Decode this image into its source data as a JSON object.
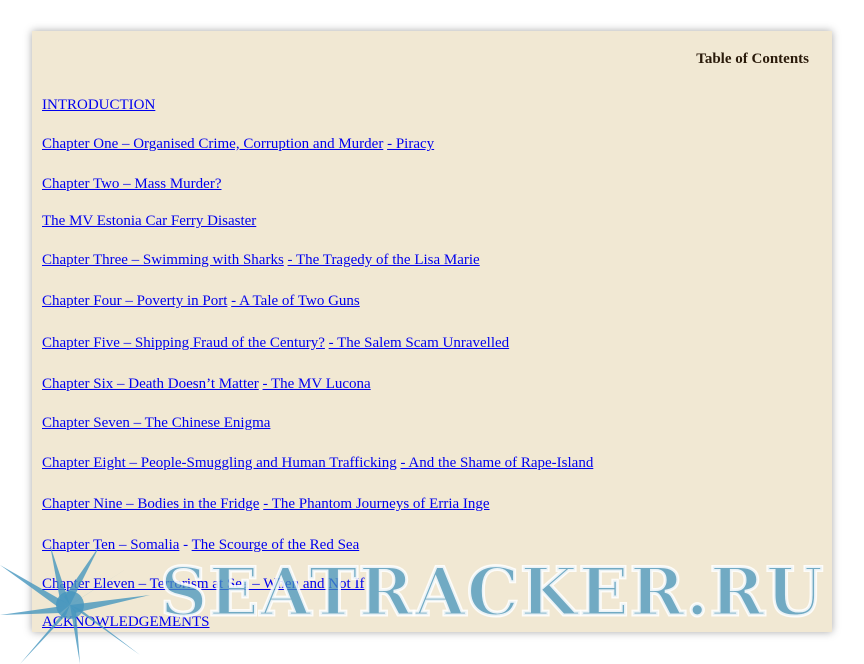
{
  "toc": {
    "title": "Table of Contents",
    "entries": [
      {
        "a": "INTRODUCTION",
        "b": ""
      },
      {
        "a": "Chapter One – Organised Crime, Corruption and Murder",
        "b": "- Piracy"
      },
      {
        "a": "Chapter Two – Mass Murder?",
        "b": ""
      },
      {
        "a": "The MV Estonia Car Ferry Disaster",
        "b": ""
      },
      {
        "a": "Chapter Three – Swimming with Sharks",
        "b": "- The Tragedy of the Lisa Marie"
      },
      {
        "a": "Chapter Four – Poverty in Port",
        "b": "- A Tale of Two Guns"
      },
      {
        "a": "Chapter Five – Shipping Fraud of the Century?",
        "b": "- The Salem Scam Unravelled"
      },
      {
        "a": "Chapter Six – Death Doesn’t Matter",
        "b": "- The MV Lucona"
      },
      {
        "a": "Chapter Seven – The Chinese Enigma",
        "b": ""
      },
      {
        "a": "Chapter Eight – People-Smuggling and Human Trafficking",
        "b": "- And the Shame of Rape-Island"
      },
      {
        "a": "Chapter Nine – Bodies in the Fridge",
        "b": "- The Phantom Journeys of Erria Inge"
      },
      {
        "a": "Chapter Ten – Somalia",
        "sep": " - ",
        "b": "The Scourge of the Red Sea"
      },
      {
        "a": "Chapter Eleven – Terrorism at Sea – When and Not If",
        "b": ""
      },
      {
        "a": "ACKNOWLEDGEMENTS",
        "b": ""
      }
    ]
  },
  "watermark": {
    "text": "SEATRACKER.RU",
    "color": "#4696be"
  }
}
